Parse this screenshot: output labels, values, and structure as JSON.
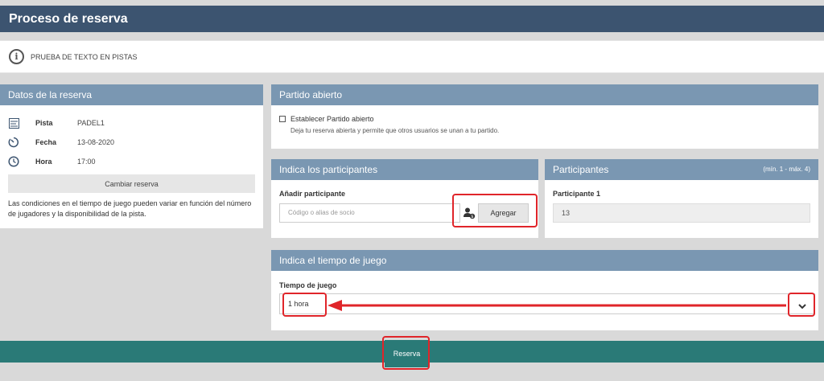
{
  "header": {
    "title": "Proceso de reserva"
  },
  "notice": {
    "text": "PRUEBA DE TEXTO EN PISTAS",
    "icon": "info-icon"
  },
  "datos": {
    "title": "Datos de la reserva",
    "rows": [
      {
        "icon": "court-icon",
        "key": "Pista",
        "value": "PADEL1"
      },
      {
        "icon": "timer-icon",
        "key": "Fecha",
        "value": "13-08-2020"
      },
      {
        "icon": "clock-icon",
        "key": "Hora",
        "value": "17:00"
      }
    ],
    "change_button": "Cambiar reserva",
    "conditions": "Las condiciones en el tiempo de juego pueden variar en función del número de jugadores y la disponibilidad de la pista."
  },
  "partido": {
    "title": "Partido abierto",
    "checkbox_label": "Establecer Partido abierto",
    "checkbox_checked": false,
    "description": "Deja tu reserva abierta y permite que otros usuarios se unan a tu partido."
  },
  "indica": {
    "title": "Indica los participantes",
    "add_label": "Añadir participante",
    "input_placeholder": "Código o alias de socio",
    "add_button": "Agregar"
  },
  "participantes": {
    "title": "Participantes",
    "range": "(mín. 1 - máx. 4)",
    "items": [
      {
        "label": "Participante 1",
        "value": "13"
      }
    ]
  },
  "tiempo": {
    "title": "Indica el tiempo de juego",
    "label": "Tiempo de juego",
    "selected": "1 hora"
  },
  "footer": {
    "reserve_button": "Reserva"
  },
  "colors": {
    "header": "#3c5470",
    "panel_head": "#7a97b2",
    "footer": "#2a7a77",
    "highlight": "#e0252a"
  }
}
